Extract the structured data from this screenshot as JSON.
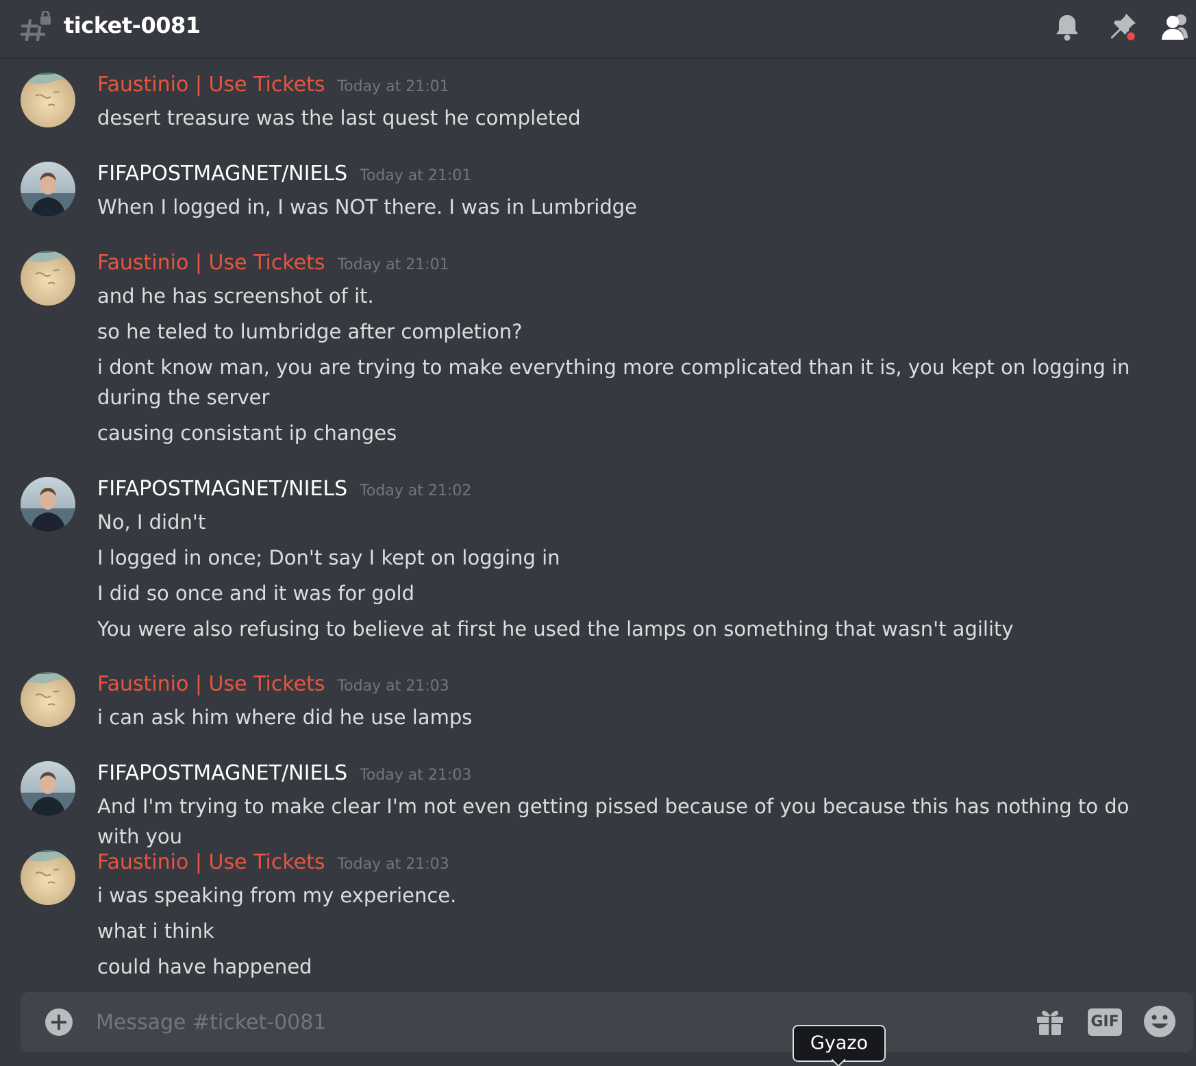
{
  "header": {
    "channel_name": "ticket-0081",
    "channel_icon": "locked-hash-icon",
    "icons": [
      "bell-icon",
      "pin-icon",
      "members-icon"
    ]
  },
  "colors": {
    "background": "#36393f",
    "staff_name": "#e8553f",
    "user_name": "#ffffff",
    "timestamp": "#72767d",
    "text": "#dcddde",
    "composer": "#40444b",
    "pin_badge": "#f04747"
  },
  "messages": [
    {
      "author": "Faustinio | Use Tickets",
      "role": "staff",
      "avatar": "beach-sand-avatar",
      "time": "Today at 21:01",
      "lines": [
        "desert treasure was the last quest he completed"
      ]
    },
    {
      "author": "FIFAPOSTMAGNET/NIELS",
      "role": "user",
      "avatar": "person-photo-avatar",
      "time": "Today at 21:01",
      "lines": [
        "When I logged in, I was NOT there. I was in Lumbridge"
      ]
    },
    {
      "author": "Faustinio | Use Tickets",
      "role": "staff",
      "avatar": "beach-sand-avatar",
      "time": "Today at 21:01",
      "lines": [
        "and he has screenshot of it.",
        "so he teled to lumbridge after completion?",
        "i dont know man, you are trying to make everything more complicated than it is, you kept on logging in during the server",
        "causing consistant ip changes"
      ]
    },
    {
      "author": "FIFAPOSTMAGNET/NIELS",
      "role": "user",
      "avatar": "person-photo-avatar",
      "time": "Today at 21:02",
      "lines": [
        "No, I didn't",
        "I logged in once; Don't say I kept on logging in",
        "I did so once and it was for gold",
        "You were also refusing to believe at first he used the lamps on something that wasn't agility"
      ]
    },
    {
      "author": "Faustinio | Use Tickets",
      "role": "staff",
      "avatar": "beach-sand-avatar",
      "time": "Today at 21:03",
      "lines": [
        "i can ask him where did he use lamps"
      ]
    },
    {
      "author": "FIFAPOSTMAGNET/NIELS",
      "role": "user",
      "avatar": "person-photo-avatar",
      "time": "Today at 21:03",
      "lines": [
        "And I'm trying to make clear I'm not even getting pissed because of you because this has nothing to do with you"
      ]
    },
    {
      "author": "Faustinio | Use Tickets",
      "role": "staff",
      "avatar": "beach-sand-avatar",
      "time": "Today at 21:03",
      "lines": [
        "i was speaking from my experience.",
        "what i think",
        "could have happened"
      ]
    }
  ],
  "composer": {
    "placeholder": "Message #ticket-0081",
    "value": "",
    "gif_label": "GIF",
    "icons": [
      "plus-icon",
      "gift-icon",
      "gif-icon",
      "emoji-icon"
    ]
  },
  "tooltip": {
    "text": "Gyazo"
  }
}
